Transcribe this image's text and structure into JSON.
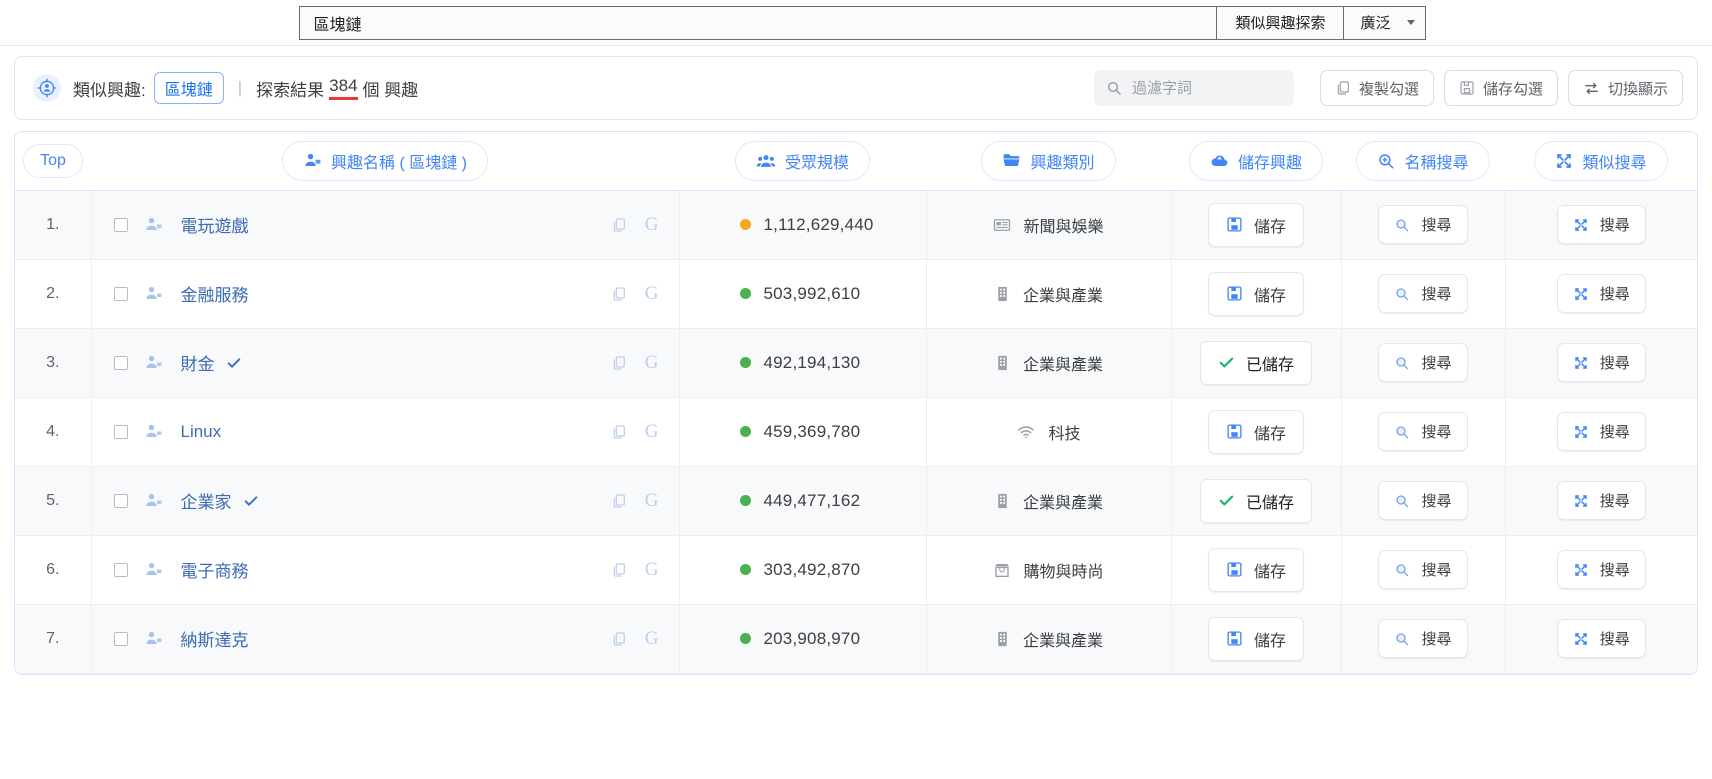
{
  "topbar": {
    "query_value": "區塊鏈",
    "explore_button": "類似興趣探索",
    "scope_select": "廣泛"
  },
  "infobar": {
    "icon": "target-person-icon",
    "label": "類似興趣:",
    "chip": "區塊鏈",
    "divider": "|",
    "result_prefix": "探索結果",
    "count": "384",
    "result_suffix": "個 興趣",
    "filter_placeholder": "過濾字詞",
    "filter_value": "",
    "copy_checked_button": "複製勾選",
    "save_checked_button": "儲存勾選",
    "toggle_display_button": "切換顯示"
  },
  "table": {
    "headers": {
      "rank": "Top",
      "name": "興趣名稱 ( 區塊鏈 )",
      "audience": "受眾規模",
      "category": "興趣類別",
      "save": "儲存興趣",
      "name_search": "名稱搜尋",
      "similar_search": "類似搜尋"
    },
    "rows": [
      {
        "index": "1.",
        "name": "電玩遊戲",
        "verified": false,
        "dot_color": "#f5a623",
        "audience": "1,112,629,440",
        "category": "新聞與娛樂",
        "category_icon": "news-icon",
        "save_label": "儲存",
        "saved": false,
        "name_search_label": "搜尋",
        "similar_search_label": "搜尋"
      },
      {
        "index": "2.",
        "name": "金融服務",
        "verified": false,
        "dot_color": "#4caf50",
        "audience": "503,992,610",
        "category": "企業與產業",
        "category_icon": "building-icon",
        "save_label": "儲存",
        "saved": false,
        "name_search_label": "搜尋",
        "similar_search_label": "搜尋"
      },
      {
        "index": "3.",
        "name": "財金",
        "verified": true,
        "dot_color": "#4caf50",
        "audience": "492,194,130",
        "category": "企業與產業",
        "category_icon": "building-icon",
        "save_label": "已儲存",
        "saved": true,
        "name_search_label": "搜尋",
        "similar_search_label": "搜尋"
      },
      {
        "index": "4.",
        "name": "Linux",
        "verified": false,
        "dot_color": "#4caf50",
        "audience": "459,369,780",
        "category": "科技",
        "category_icon": "wifi-icon",
        "save_label": "儲存",
        "saved": false,
        "name_search_label": "搜尋",
        "similar_search_label": "搜尋"
      },
      {
        "index": "5.",
        "name": "企業家",
        "verified": true,
        "dot_color": "#4caf50",
        "audience": "449,477,162",
        "category": "企業與產業",
        "category_icon": "building-icon",
        "save_label": "已儲存",
        "saved": true,
        "name_search_label": "搜尋",
        "similar_search_label": "搜尋"
      },
      {
        "index": "6.",
        "name": "電子商務",
        "verified": false,
        "dot_color": "#4caf50",
        "audience": "303,492,870",
        "category": "購物與時尚",
        "category_icon": "shop-icon",
        "save_label": "儲存",
        "saved": false,
        "name_search_label": "搜尋",
        "similar_search_label": "搜尋"
      },
      {
        "index": "7.",
        "name": "納斯達克",
        "verified": false,
        "dot_color": "#4caf50",
        "audience": "203,908,970",
        "category": "企業與產業",
        "category_icon": "building-icon",
        "save_label": "儲存",
        "saved": false,
        "name_search_label": "搜尋",
        "similar_search_label": "搜尋"
      }
    ]
  },
  "colors": {
    "accent": "#4285f4",
    "link": "#3b6bb5",
    "green": "#4caf50",
    "orange": "#f5a623",
    "underline_red": "#e53935"
  }
}
